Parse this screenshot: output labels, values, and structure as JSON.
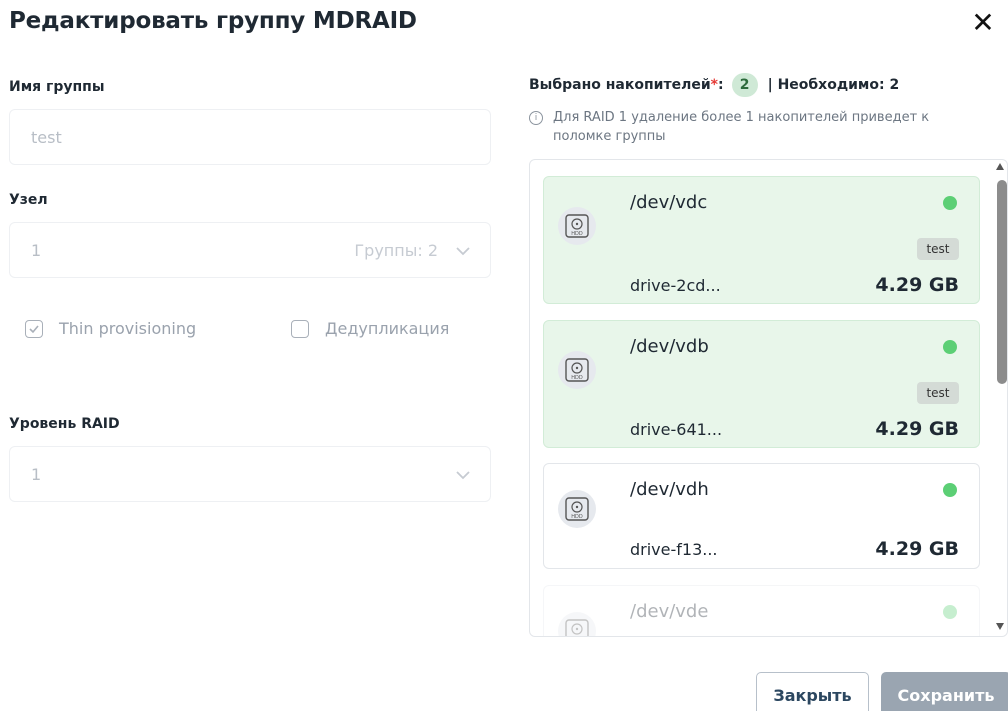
{
  "dialog": {
    "title": "Редактировать группу MDRAID",
    "close_glyph": "✕"
  },
  "form": {
    "group_name": {
      "label": "Имя группы",
      "value": "test"
    },
    "node": {
      "label": "Узел",
      "value": "1",
      "hint": "Группы: 2"
    },
    "thin_provisioning": {
      "label": "Thin provisioning",
      "checked": true
    },
    "deduplication": {
      "label": "Дедупликация",
      "checked": false
    },
    "raid_level": {
      "label": "Уровень RAID",
      "value": "1"
    }
  },
  "drives_panel": {
    "selected_label": "Выбрано накопителей",
    "required_mark": "*",
    "colon": ":",
    "selected_count": "2",
    "needed": "| Необходимо: 2",
    "info": "Для RAID 1 удаление более 1 накопителей приведет к поломке группы",
    "drives": [
      {
        "name": "/dev/vdc",
        "id": "drive-2cd...",
        "size": "4.29 GB",
        "tag": "test",
        "selected": true,
        "status_color": "#5ccf75"
      },
      {
        "name": "/dev/vdb",
        "id": "drive-641...",
        "size": "4.29 GB",
        "tag": "test",
        "selected": true,
        "status_color": "#5ccf75"
      },
      {
        "name": "/dev/vdh",
        "id": "drive-f13...",
        "size": "4.29 GB",
        "tag": "",
        "selected": false,
        "status_color": "#5ccf75"
      },
      {
        "name": "/dev/vde",
        "id": "",
        "size": "",
        "tag": "",
        "selected": false,
        "status_color": "#5ccf75"
      }
    ]
  },
  "actions": {
    "close_label": "Закрыть",
    "save_label": "Сохранить"
  },
  "colors": {
    "selected_card_bg": "#e8f6ea",
    "status_ok": "#5ccf75",
    "required": "#e53935",
    "save_disabled": "#9aa5b1"
  }
}
